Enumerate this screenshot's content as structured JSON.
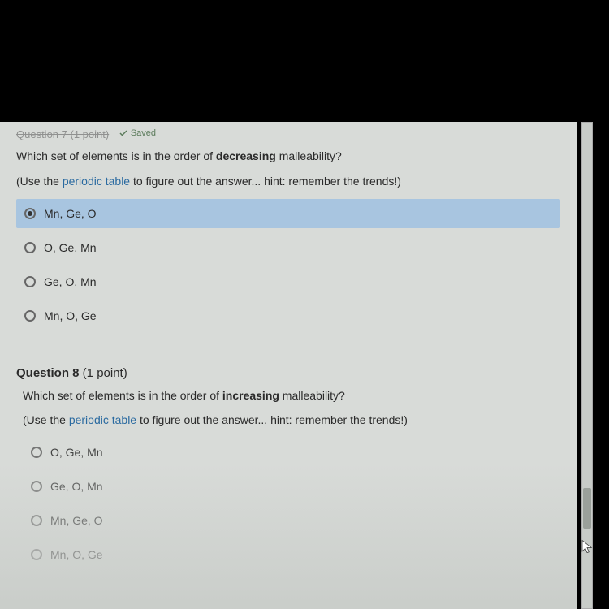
{
  "q7": {
    "header_partial": "Question 7 (1 point)",
    "saved_label": "Saved",
    "prompt_pre": "Which set of elements is in the order of ",
    "prompt_bold": "decreasing",
    "prompt_post": " malleability?",
    "hint_pre": "(Use the ",
    "hint_link": "periodic table",
    "hint_post": " to figure out the answer... hint: remember the trends!)",
    "options": {
      "a": "Mn, Ge, O",
      "b": "O, Ge, Mn",
      "c": "Ge, O, Mn",
      "d": "Mn, O, Ge"
    }
  },
  "q8": {
    "header_bold": "Question 8",
    "header_points": " (1 point)",
    "prompt_pre": "Which set of elements is in the order of ",
    "prompt_bold": "increasing",
    "prompt_post": " malleability?",
    "hint_pre": "(Use the ",
    "hint_link": "periodic table",
    "hint_post": " to figure out the answer... hint: remember the trends!)",
    "options": {
      "a": "O, Ge, Mn",
      "b": "Ge, O, Mn",
      "c": "Mn, Ge, O",
      "d": "Mn, O, Ge"
    }
  }
}
